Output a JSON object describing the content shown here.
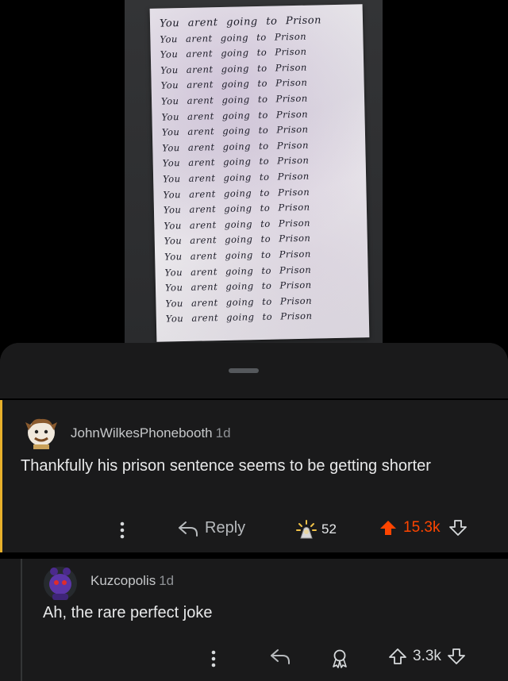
{
  "photo": {
    "note_lines": [
      "You arent going to Prison",
      "You arent going to Prison",
      "You arent going to Prison",
      "You arent going to Prison",
      "You arent going to Prison",
      "You arent going to Prison",
      "You arent going to Prison",
      "You arent going to Prison",
      "You arent going to Prison",
      "You arent going to Prison",
      "You arent going to Prison",
      "You arent going to Prison",
      "You arent going to Prison",
      "You arent going to Prison",
      "You arent going to Prison",
      "You arent going to Prison",
      "You arent going to Prison",
      "You arent going to Prison",
      "You arent going to Prison",
      "You arent going to Prison"
    ]
  },
  "comments": [
    {
      "author": "JohnWilkesPhonebooth",
      "age": "1d",
      "body": "Thankfully his prison sentence seems to be getting shorter",
      "reply_label": "Reply",
      "award_count": "52",
      "score": "15.3k",
      "accent_color": "#e7b02b",
      "upvote_color": "#ff4500"
    },
    {
      "author": "Kuzcopolis",
      "age": "1d",
      "body": "Ah, the rare perfect joke",
      "score": "3.3k"
    }
  ]
}
